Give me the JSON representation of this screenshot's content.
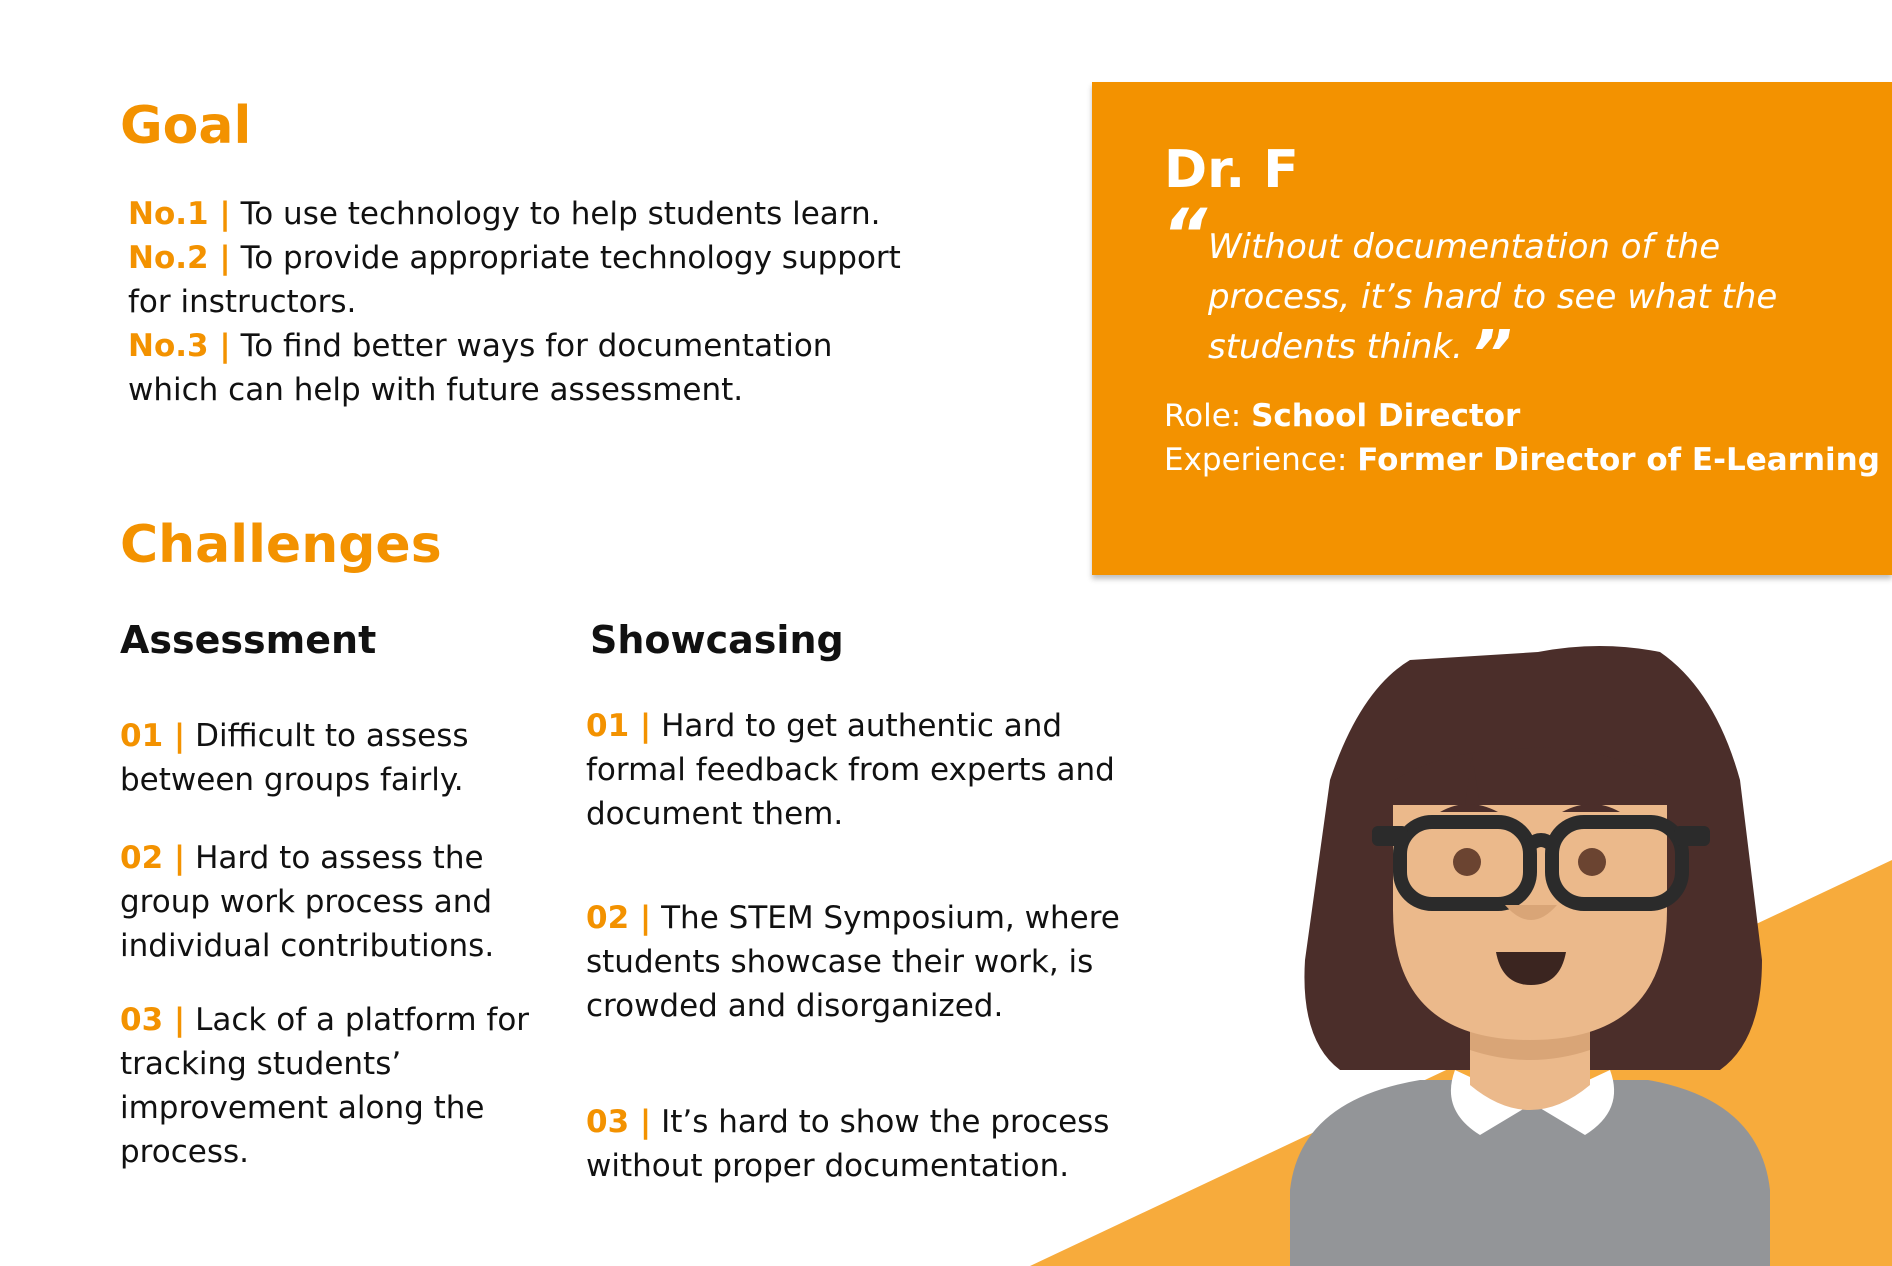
{
  "goal": {
    "heading": "Goal",
    "items": [
      {
        "num": "No.1 |",
        "text": "To use technology to help students learn."
      },
      {
        "num": "No.2 |",
        "text": "To provide appropriate technology support for instructors."
      },
      {
        "num": "No.3 |",
        "text": "To find better ways for documentation which can help with future assessment."
      }
    ]
  },
  "persona": {
    "name": "Dr. F",
    "quote": "Without documentation of the process, it’s hard to see what the students think.",
    "role_label": "Role:",
    "role_value": "School Director",
    "experience_label": "Experience:",
    "experience_value": "Former Director of E-Learning"
  },
  "challenges": {
    "heading": "Challenges",
    "assessment": {
      "title": "Assessment",
      "items": [
        {
          "num": "01 |",
          "text": "Difficult to assess between groups fairly."
        },
        {
          "num": "02 |",
          "text": "Hard to assess the group work process and individual contributions."
        },
        {
          "num": "03 |",
          "text": "Lack of a platform for tracking students’ improvement along the process."
        }
      ]
    },
    "showcasing": {
      "title": "Showcasing",
      "items": [
        {
          "num": "01 |",
          "text": "Hard to get authentic and formal feedback from experts and document them."
        },
        {
          "num": "02 |",
          "text": "The STEM Symposium, where students showcase their work, is crowded and disorganized."
        },
        {
          "num": "03 |",
          "text": "It’s hard to show the process without proper documentation."
        }
      ]
    }
  },
  "colors": {
    "accent": "#f39200",
    "accent_light": "#f7ab3c",
    "hair": "#4b2e2a",
    "skin": "#ebb98b",
    "shirt": "#939598"
  },
  "icons": [
    "persona-avatar-illustration",
    "quote-open-icon",
    "quote-close-icon"
  ]
}
